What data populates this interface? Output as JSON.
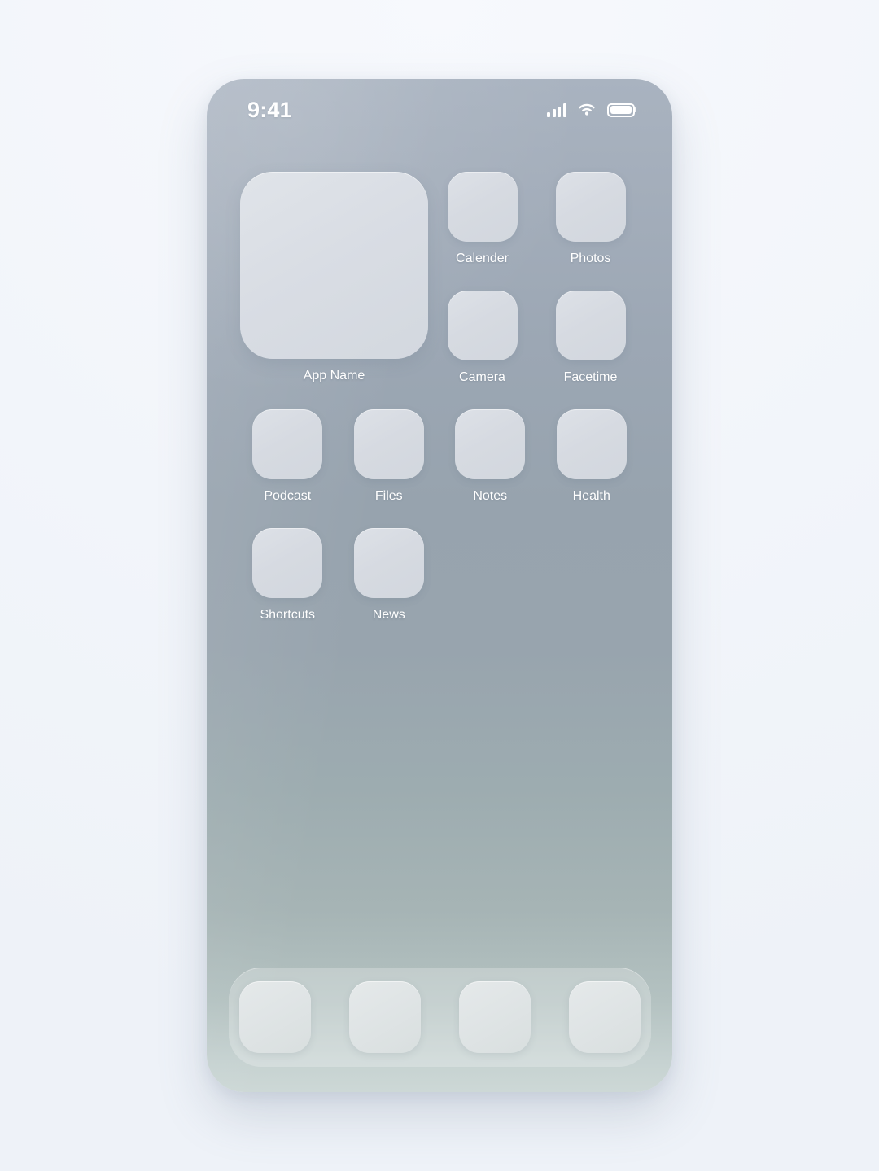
{
  "status_bar": {
    "time": "9:41",
    "signal_icon": "cellular-signal-icon",
    "wifi_icon": "wifi-icon",
    "battery_icon": "battery-full-icon",
    "signal_bars": 4,
    "battery_level": 100
  },
  "home_screen": {
    "widget": {
      "label": "App Name",
      "size": "large"
    },
    "apps": [
      {
        "label": "Calender"
      },
      {
        "label": "Photos"
      },
      {
        "label": "Camera"
      },
      {
        "label": "Facetime"
      },
      {
        "label": "Podcast"
      },
      {
        "label": "Files"
      },
      {
        "label": "Notes"
      },
      {
        "label": "Health"
      },
      {
        "label": "Shortcuts"
      },
      {
        "label": "News"
      }
    ]
  },
  "dock": {
    "items": [
      {
        "label": ""
      },
      {
        "label": ""
      },
      {
        "label": ""
      },
      {
        "label": ""
      }
    ]
  },
  "colors": {
    "page_background": "#f4f6fb",
    "wallpaper_top": "#a9b3c0",
    "wallpaper_mid": "#97a3ae",
    "wallpaper_bottom": "#cdd8d6",
    "icon_fill": "#d6dae1",
    "label_text": "#ffffff",
    "dock_background": "rgba(255,255,255,0.24)"
  }
}
